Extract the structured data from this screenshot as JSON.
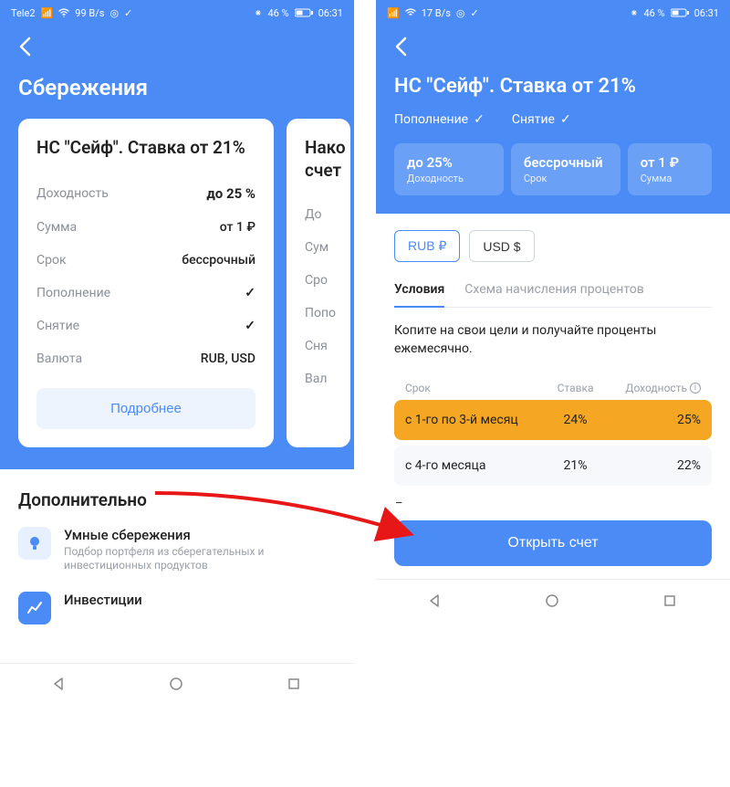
{
  "status": {
    "carrier": "Tele2",
    "speed_left": "99 B/s",
    "speed_right": "17 B/s",
    "battery": "46 %",
    "time": "06:31",
    "bt_icon": "⁕"
  },
  "left": {
    "page_title": "Сбережения",
    "card1": {
      "title": "НС \"Сейф\". Ставка от 21%",
      "rows": {
        "yield_label": "Доходность",
        "yield_value": "до 25 %",
        "amount_label": "Сумма",
        "amount_value": "от 1 ₽",
        "term_label": "Срок",
        "term_value": "бессрочный",
        "topup_label": "Пополнение",
        "withdraw_label": "Снятие",
        "currency_label": "Валюта",
        "currency_value": "RUB, USD"
      },
      "button": "Подробнее"
    },
    "card2": {
      "title_part": "Нако",
      "subtitle_part": "счет",
      "yield_label": "До",
      "amount_label": "Сум",
      "term_label": "Сро",
      "topup_label": "Попо",
      "withdraw_label": "Сня",
      "currency_label": "Вал"
    },
    "additional": {
      "heading": "Дополнительно",
      "item1_title": "Умные сбережения",
      "item1_desc": "Подбор портфеля из сберегательных и инвестиционных продуктов",
      "item2_title": "Инвестиции"
    }
  },
  "right": {
    "product_title": "НС \"Сейф\". Ставка от 21%",
    "feat_topup": "Пополнение",
    "feat_withdraw": "Снятие",
    "stats": {
      "yield_big": "до 25%",
      "yield_small": "Доходность",
      "term_big": "бессрочный",
      "term_small": "Срок",
      "amount_big": "от 1 ₽",
      "amount_small": "Сумма"
    },
    "currency": {
      "rub": "RUB ₽",
      "usd": "USD $"
    },
    "tabs": {
      "conditions": "Условия",
      "scheme": "Схема начисления процентов"
    },
    "description": "Копите на свои цели и получайте проценты ежемесячно.",
    "table": {
      "col_term": "Срок",
      "col_rate": "Ставка",
      "col_yield": "Доходность",
      "row1_term": "с 1-го по 3-й месяц",
      "row1_rate": "24%",
      "row1_yield": "25%",
      "row2_term": "с 4-го месяца",
      "row2_rate": "21%",
      "row2_yield": "22%"
    },
    "open_button": "Открыть счет"
  }
}
